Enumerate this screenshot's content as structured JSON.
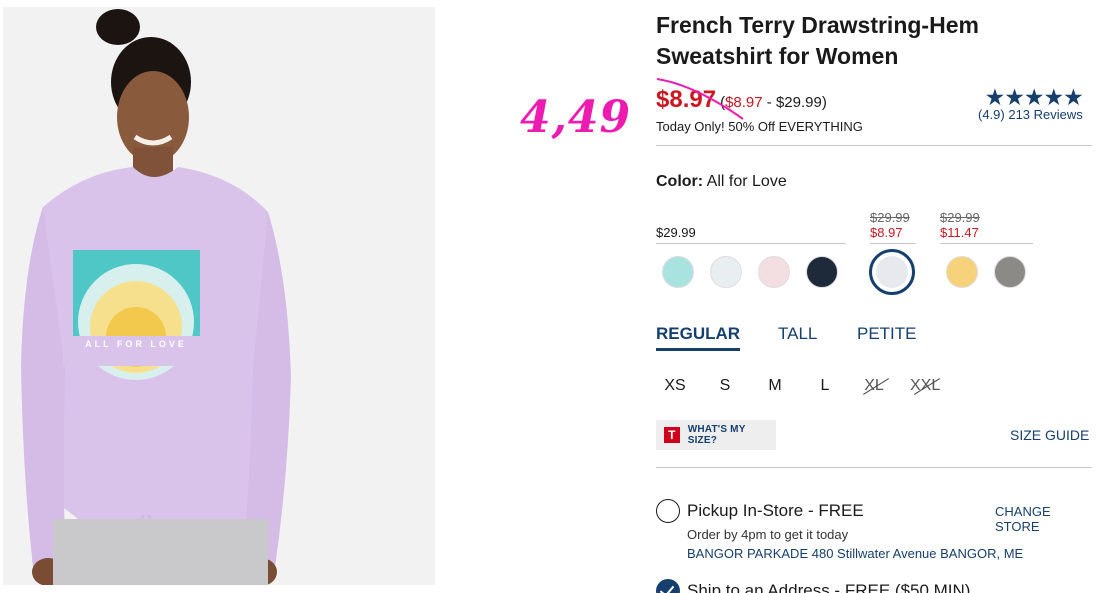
{
  "product": {
    "title": "French Terry Drawstring-Hem Sweatshirt for Women",
    "sale_price": "$8.97",
    "range_prefix": "(",
    "range_low": "$8.97",
    "range_rest": " - $29.99)",
    "promo": "Today Only! 50% Off EVERYTHING",
    "handwritten_price": "4,49",
    "image_print_text": "ALL FOR LOVE"
  },
  "rating": {
    "stars": "★★★★★",
    "reviews": "(4.9) 213 Reviews"
  },
  "color": {
    "label": "Color:",
    "value": "All for Love",
    "groups": [
      {
        "regular": "$29.99"
      },
      {
        "old": "$29.99",
        "new": "$8.97"
      },
      {
        "old": "$29.99",
        "new": "$11.47"
      }
    ],
    "swatches": [
      {
        "name": "mint",
        "color": "#a9e3e0"
      },
      {
        "name": "white-print",
        "color": "#e9eef3"
      },
      {
        "name": "pale-pink",
        "color": "#f3dfe1"
      },
      {
        "name": "navy-burst",
        "color": "#1e2a3a"
      },
      {
        "name": "all-for-love",
        "color": "#e7e9ee",
        "selected": true
      },
      {
        "name": "yellow-print",
        "color": "#f6d37a"
      },
      {
        "name": "grey-print",
        "color": "#8c8a86"
      }
    ]
  },
  "fit_tabs": [
    "REGULAR",
    "TALL",
    "PETITE"
  ],
  "sizes": [
    {
      "label": "XS",
      "available": true
    },
    {
      "label": "S",
      "available": true
    },
    {
      "label": "M",
      "available": true
    },
    {
      "label": "L",
      "available": true
    },
    {
      "label": "XL",
      "available": false
    },
    {
      "label": "XXL",
      "available": false
    }
  ],
  "size_help": {
    "logo": "T",
    "whats_my_size": "WHAT'S MY SIZE?",
    "size_guide": "SIZE GUIDE"
  },
  "fulfillment": {
    "pickup_title": "Pickup In-Store - FREE",
    "change_store": "CHANGE STORE",
    "pickup_note": "Order by 4pm to get it today",
    "store_address": "BANGOR PARKADE 480 Stillwater Avenue  BANGOR, ME",
    "ship_title": "Ship to an Address - FREE ($50 MIN)"
  },
  "colors": {
    "brand_navy": "#163f6d",
    "sale_red": "#cc1620",
    "handwriting_pink": "#ee1bb0"
  }
}
